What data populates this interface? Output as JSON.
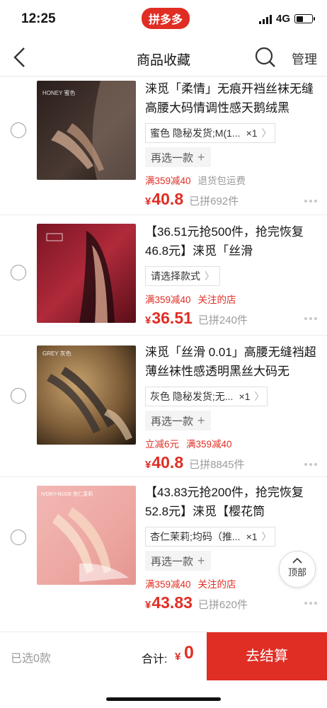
{
  "status_bar": {
    "time": "12:25",
    "app_badge": "拼多多",
    "network": "4G"
  },
  "nav": {
    "title": "商品收藏",
    "manage": "管理"
  },
  "items": [
    {
      "title": "涞觅「柔情」无痕开裆丝袜无缝高腰大码情调性感天鹅绒黑",
      "spec": "蜜色 隐秘发货;M(1...",
      "qty": "×1",
      "reselect": "再选一款",
      "promos": [
        {
          "text": "满359减40",
          "style": "red"
        },
        {
          "text": "退货包运费",
          "style": "gray"
        }
      ],
      "yen": "¥",
      "price": "40.8",
      "sold": "已拼692件"
    },
    {
      "title": "【36.51元抢500件，抢完恢复46.8元】涞觅「丝滑",
      "choose": "请选择款式",
      "promos": [
        {
          "text": "满359减40",
          "style": "red"
        },
        {
          "text": "关注的店",
          "style": "red"
        }
      ],
      "yen": "¥",
      "price": "36.51",
      "sold": "已拼240件"
    },
    {
      "title": "涞觅「丝滑 0.01」高腰无缝裆超薄丝袜性感透明黑丝大码无",
      "spec": "灰色 隐秘发货;无...",
      "qty": "×1",
      "reselect": "再选一款",
      "promos": [
        {
          "text": "立减6元",
          "style": "red"
        },
        {
          "text": "满359减40",
          "style": "red"
        }
      ],
      "yen": "¥",
      "price": "40.8",
      "sold": "已拼8845件"
    },
    {
      "title": "【43.83元抢200件，抢完恢复52.8元】涞觅【樱花筒",
      "spec": "杏仁茉莉;均码（推...",
      "qty": "×1",
      "reselect": "再选一款",
      "promos": [
        {
          "text": "满359减40",
          "style": "red"
        },
        {
          "text": "关注的店",
          "style": "red"
        }
      ],
      "yen": "¥",
      "price": "43.83",
      "sold": "已拼620件"
    }
  ],
  "thumb_labels": {
    "item0": "HONEY 蜜色",
    "item2": "GREY 灰色",
    "item3": "IVORY-NUDE 杏仁茉莉"
  },
  "to_top": "顶部",
  "bottom_bar": {
    "selected": "已选0款",
    "total_label": "合计:",
    "yen": "¥",
    "total": "0",
    "checkout": "去结算"
  },
  "colors": {
    "accent": "#e02e24",
    "muted": "#9c9c9c"
  }
}
